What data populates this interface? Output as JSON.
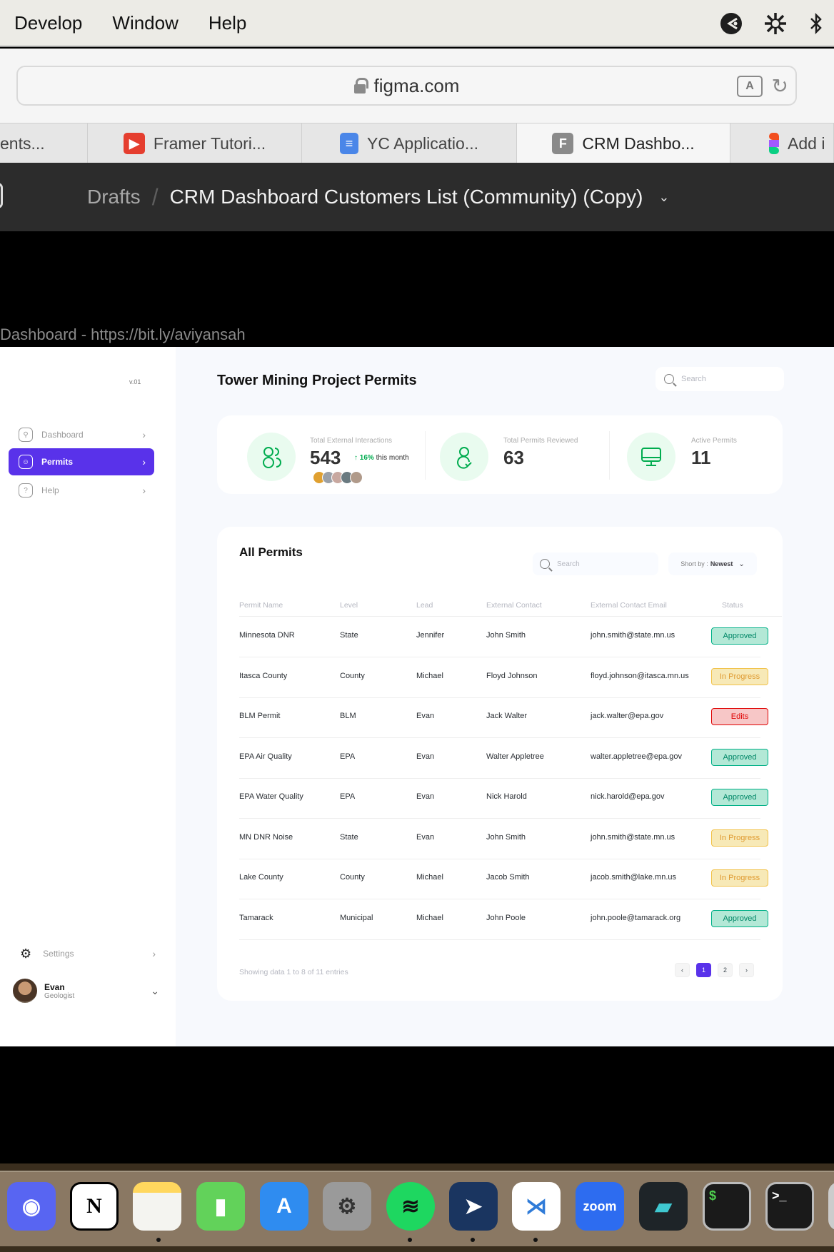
{
  "menubar": {
    "items": [
      "Develop",
      "Window",
      "Help"
    ],
    "status_icons": [
      "vpn-icon",
      "brightness-icon",
      "bluetooth-icon"
    ]
  },
  "browser": {
    "url": "figma.com",
    "tabs": [
      {
        "label": "ents...",
        "icon": "none",
        "active": false
      },
      {
        "label": "Framer Tutori...",
        "icon": "youtube-icon",
        "active": false
      },
      {
        "label": "YC Applicatio...",
        "icon": "google-docs-icon",
        "active": false
      },
      {
        "label": "CRM Dashbo...",
        "icon": "figma-file-icon",
        "active": true
      },
      {
        "label": "Add i",
        "icon": "figma-icon",
        "active": false
      }
    ]
  },
  "figma": {
    "breadcrumb_root": "Drafts",
    "breadcrumb_sep": "/",
    "file_name": "CRM Dashboard Customers List (Community) (Copy)",
    "frame_label": "Dashboard - https://bit.ly/aviyansah"
  },
  "dashboard": {
    "version": "v.01",
    "nav": [
      {
        "label": "Dashboard",
        "icon": "key-icon",
        "active": false
      },
      {
        "label": "Permits",
        "icon": "user-square-icon",
        "active": true
      },
      {
        "label": "Help",
        "icon": "help-icon",
        "active": false
      }
    ],
    "settings_label": "Settings",
    "user": {
      "name": "Evan",
      "role": "Geologist"
    },
    "page_title": "Tower Mining Project Permits",
    "search_placeholder": "Search",
    "stats": [
      {
        "label": "Total External Interactions",
        "value": "543",
        "trend_value": "16%",
        "trend_text": "this month",
        "icon": "users-icon"
      },
      {
        "label": "Total Permits Reviewed",
        "value": "63",
        "icon": "user-check-icon"
      },
      {
        "label": "Active Permits",
        "value": "11",
        "icon": "monitor-icon"
      }
    ],
    "table": {
      "title": "All Permits",
      "search_placeholder": "Search",
      "sort_label": "Short by :",
      "sort_value": "Newest",
      "columns": [
        "Permit Name",
        "Level",
        "Lead",
        "External Contact",
        "External Contact Email",
        "Status"
      ],
      "rows": [
        {
          "name": "Minnesota DNR",
          "level": "State",
          "lead": "Jennifer",
          "contact": "John Smith",
          "email": "john.smith@state.mn.us",
          "status": "Approved"
        },
        {
          "name": "Itasca County",
          "level": "County",
          "lead": "Michael",
          "contact": "Floyd Johnson",
          "email": "floyd.johnson@itasca.mn.us",
          "status": "In Progress"
        },
        {
          "name": "BLM Permit",
          "level": "BLM",
          "lead": "Evan",
          "contact": "Jack Walter",
          "email": "jack.walter@epa.gov",
          "status": "Edits"
        },
        {
          "name": "EPA Air Quality",
          "level": "EPA",
          "lead": "Evan",
          "contact": "Walter Appletree",
          "email": "walter.appletree@epa.gov",
          "status": "Approved"
        },
        {
          "name": "EPA Water Quality",
          "level": "EPA",
          "lead": "Evan",
          "contact": "Nick Harold",
          "email": "nick.harold@epa.gov",
          "status": "Approved"
        },
        {
          "name": "MN DNR Noise",
          "level": "State",
          "lead": "Evan",
          "contact": "John Smith",
          "email": "john.smith@state.mn.us",
          "status": "In Progress"
        },
        {
          "name": "Lake County",
          "level": "County",
          "lead": "Michael",
          "contact": "Jacob Smith",
          "email": "jacob.smith@lake.mn.us",
          "status": "In Progress"
        },
        {
          "name": "Tamarack",
          "level": "Municipal",
          "lead": "Michael",
          "contact": "John Poole",
          "email": "john.poole@tamarack.org",
          "status": "Approved"
        }
      ],
      "footer": "Showing data 1 to 8 of 11 entries",
      "pages": [
        "‹",
        "1",
        "2",
        "›"
      ],
      "current_page": "1"
    },
    "colors": {
      "accent": "#5932ea",
      "approved": "#00b087",
      "in_progress": "#f1c24a",
      "edits": "#df0404",
      "stat_green": "#00ac4f"
    }
  },
  "dock": {
    "apps": [
      {
        "name": "Discord",
        "running": false
      },
      {
        "name": "Notion",
        "running": false
      },
      {
        "name": "Notes",
        "running": true
      },
      {
        "name": "Numbers",
        "running": false
      },
      {
        "name": "App Store",
        "running": false
      },
      {
        "name": "System Preferences",
        "running": false
      },
      {
        "name": "Spotify",
        "running": true
      },
      {
        "name": "Copilot",
        "running": true
      },
      {
        "name": "Visual Studio Code",
        "running": true
      },
      {
        "name": "Zoom",
        "running": false
      },
      {
        "name": "Screens",
        "running": false
      },
      {
        "name": "Terminal",
        "running": false
      },
      {
        "name": "Terminal 2",
        "running": false
      }
    ],
    "zoom_label": "zoom"
  }
}
